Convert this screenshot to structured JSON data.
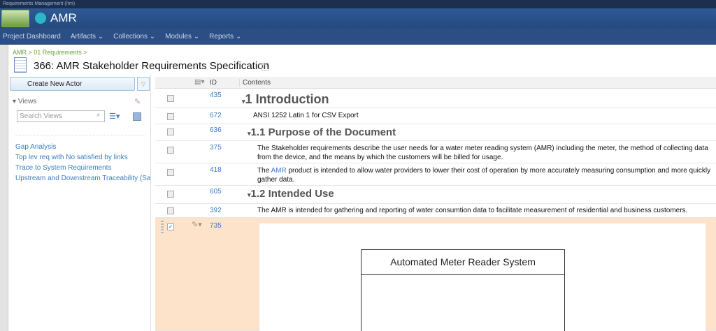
{
  "app": {
    "product": "Requirements Management (/rm)",
    "project": "AMR"
  },
  "nav": [
    "Project Dashboard",
    "Artifacts ⌄",
    "Collections ⌄",
    "Modules ⌄",
    "Reports ⌄"
  ],
  "breadcrumb": "AMR > 01 Requirements >",
  "title": "366: AMR Stakeholder Requirements Specification",
  "help": "?",
  "left": {
    "create_button": "Create New Actor",
    "views_label": "Views",
    "search_placeholder": "Search Views",
    "views": [
      "Gap Analysis",
      "Top lev req with No satisfied by links",
      "Trace to System Requirements",
      "Upstream and Downstream Traceability (Sa"
    ]
  },
  "table": {
    "headers": {
      "id": "ID",
      "contents": "Contents"
    },
    "rows": [
      {
        "id": "435",
        "num": "1",
        "text": "Introduction"
      },
      {
        "id": "672",
        "text": "ANSI 1252 Latin 1 for CSV Export"
      },
      {
        "id": "636",
        "num": "1.1",
        "text": "Purpose of the Document"
      },
      {
        "id": "375",
        "text": "The Stakeholder requirements describe the user needs for a water meter reading system (AMR) including the meter, the method of collecting data from the device, and the means by which the customers will be billed for usage."
      },
      {
        "id": "418",
        "pre": "The ",
        "link": "AMR",
        "text": " product is intended to allow water providers to lower their cost of operation by more accurately measuring consumption and more quickly gather data."
      },
      {
        "id": "605",
        "num": "1.2",
        "text": "Intended Use"
      },
      {
        "id": "392",
        "text": "The AMR is intended for gathering and reporting of water consumtion data to facilitate measurement of residential and business customers."
      },
      {
        "id": "735",
        "diagram_title": "Automated Meter Reader System"
      }
    ]
  }
}
